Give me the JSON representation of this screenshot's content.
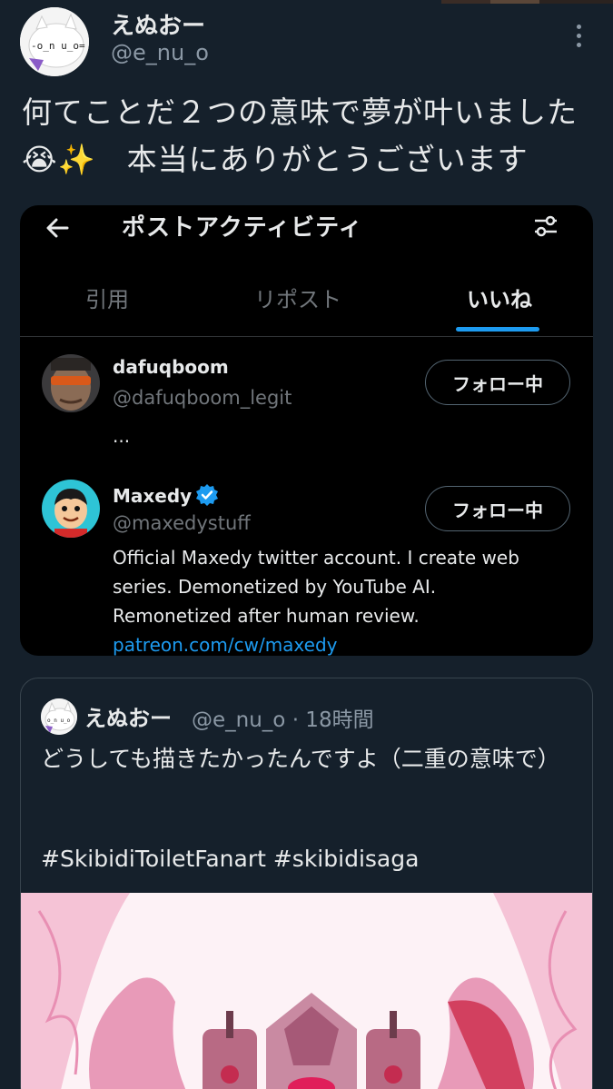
{
  "post": {
    "display_name": "えぬおー",
    "handle": "@e_nu_o",
    "text_line1": "何てことだ２つの意味で夢が叶いました",
    "text_line2": "😭✨　本当にありがとうございます"
  },
  "screenshot": {
    "title": "ポストアクティビティ",
    "tabs": [
      {
        "label": "引用"
      },
      {
        "label": "リポスト"
      },
      {
        "label": "いいね"
      }
    ],
    "active_tab": "いいね",
    "users": [
      {
        "name": "dafuqboom",
        "handle": "@dafuqboom_legit",
        "bio": "...",
        "follow_label": "フォロー中"
      },
      {
        "name": "Maxedy",
        "handle": "@maxedystuff",
        "verified": true,
        "bio_line1": "Official Maxedy twitter account. I create web",
        "bio_line2": "series. Demonetized by YouTube AI.",
        "bio_line3": "Remonetized after human review.",
        "bio_link": "patreon.com/cw/maxedy",
        "follow_label": "フォロー中"
      }
    ]
  },
  "quoted": {
    "display_name": "えぬおー",
    "meta": "@e_nu_o · 18時間",
    "text": "どうしても描きたかったんですよ（二重の意味で）",
    "hashtags": "#SkibidiToiletFanart #skibidisaga"
  },
  "colors": {
    "background": "#15202b",
    "accent": "#1d9bf0",
    "secondary_text": "#8b98a5"
  },
  "icons": [
    "back-arrow-icon",
    "filter-icon",
    "more-icon",
    "verified-icon"
  ]
}
